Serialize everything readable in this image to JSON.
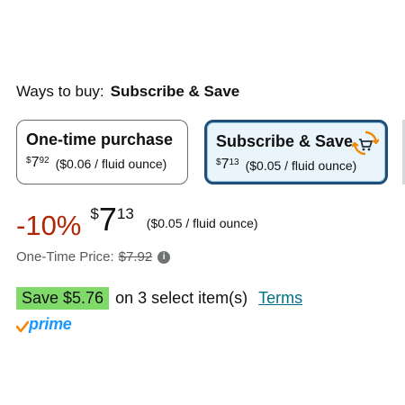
{
  "ways_to_buy": {
    "label": "Ways to buy:",
    "selected": "Subscribe & Save"
  },
  "options": [
    {
      "title": "One-time purchase",
      "price_symbol": "$",
      "price_whole": "7",
      "price_fraction": "92",
      "unit_price": "($0.06 / fluid ounce)",
      "selected": false
    },
    {
      "title": "Subscribe & Save",
      "price_symbol": "$",
      "price_whole": "7",
      "price_fraction": "13",
      "unit_price": "($0.05 / fluid ounce)",
      "selected": true,
      "icon": "subscribe-cart-icon"
    }
  ],
  "price": {
    "discount": "-10%",
    "symbol": "$",
    "whole": "7",
    "fraction": "13",
    "unit_price": "($0.05 / fluid ounce)",
    "discount_color": "#B12704"
  },
  "one_time_price": {
    "label": "One-Time Price:",
    "value": "$7.92",
    "info_icon": "i"
  },
  "savings": {
    "badge": "Save $5.76",
    "text": "on 3 select item(s)",
    "link": "Terms",
    "badge_color": "#7FDA69"
  },
  "prime": {
    "check": "✓",
    "label": "prime",
    "color": "#1A98FF"
  },
  "colors": {
    "link": "#007185",
    "selected_border": "#1D4F7A",
    "selected_bg": "#EAF5FB"
  }
}
